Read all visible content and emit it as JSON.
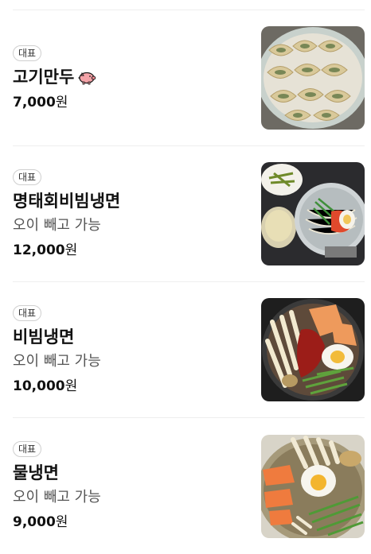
{
  "menu": {
    "items": [
      {
        "badge": "대표",
        "name": "고기만두",
        "name_icon": "pig-icon",
        "description": "",
        "price": "7,000",
        "price_unit": "원",
        "image": "dumplings-photo"
      },
      {
        "badge": "대표",
        "name": "명태회비빔냉면",
        "description": "오이 빼고 가능",
        "price": "12,000",
        "price_unit": "원",
        "image": "pollock-bibim-naengmyeon-photo"
      },
      {
        "badge": "대표",
        "name": "비빔냉면",
        "description": "오이 빼고 가능",
        "price": "10,000",
        "price_unit": "원",
        "image": "bibim-naengmyeon-photo"
      },
      {
        "badge": "대표",
        "name": "물냉면",
        "description": "오이 빼고 가능",
        "price": "9,000",
        "price_unit": "원",
        "image": "mul-naengmyeon-photo"
      }
    ]
  }
}
